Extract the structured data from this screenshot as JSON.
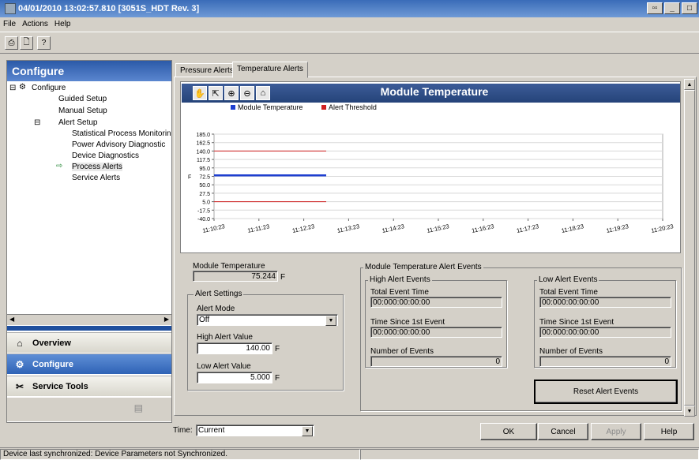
{
  "window": {
    "title": "04/01/2010 13:02:57.810 [3051S_HDT Rev. 3]"
  },
  "menu": [
    "File",
    "Actions",
    "Help"
  ],
  "left": {
    "header": "Configure",
    "tree": [
      "Configure",
      "Guided Setup",
      "Manual Setup",
      "Alert Setup",
      "Statistical Process Monitoring",
      "Power Advisory Diagnostic",
      "Device Diagnostics",
      "Process Alerts",
      "Service Alerts"
    ],
    "nav": {
      "overview": "Overview",
      "configure": "Configure",
      "service_tools": "Service Tools"
    }
  },
  "tabs": [
    "Pressure Alerts",
    "Temperature Alerts"
  ],
  "chart_data": {
    "type": "line",
    "title": "Module Temperature",
    "ylabel": "F",
    "yticks": [
      "185.0",
      "162.5",
      "140.0",
      "117.5",
      "95.0",
      "72.5",
      "50.0",
      "27.5",
      "5.0",
      "-17.5",
      "-40.0"
    ],
    "ylim": [
      -40,
      185
    ],
    "xticks": [
      "11:10:23",
      "11:11:23",
      "11:12:23",
      "11:13:23",
      "11:14:23",
      "11:15:23",
      "11:16:23",
      "11:17:23",
      "11:18:23",
      "11:19:23",
      "11:20:23"
    ],
    "series": [
      {
        "name": "Module Temperature",
        "color": "#1e3fd0",
        "x": [
          "11:10:23",
          "11:12:53"
        ],
        "values": [
          75.244,
          75.244
        ]
      },
      {
        "name": "Alert Threshold",
        "color": "#d02020",
        "x": [
          "11:10:23",
          "11:12:53"
        ],
        "values": [
          140.0,
          140.0
        ]
      },
      {
        "name": "",
        "color": "#d02020",
        "x": [
          "11:10:23",
          "11:12:53"
        ],
        "values": [
          5.0,
          5.0
        ]
      }
    ],
    "grid": true,
    "legend": "top"
  },
  "module_temp": {
    "label": "Module Temperature",
    "value": "75.244",
    "unit": "F"
  },
  "alert_settings": {
    "group": "Alert Settings",
    "mode_label": "Alert Mode",
    "mode_value": "Off",
    "high_label": "High Alert Value",
    "high_value": "140.00",
    "high_unit": "F",
    "low_label": "Low Alert Value",
    "low_value": "5.000",
    "low_unit": "F"
  },
  "events": {
    "group": "Module Temperature Alert Events",
    "high": {
      "title": "High Alert Events",
      "total_label": "Total Event Time",
      "total": "00:000:00:00:00",
      "since_label": "Time Since 1st Event",
      "since": "00:000:00:00:00",
      "count_label": "Number of Events",
      "count": "0"
    },
    "low": {
      "title": "Low Alert Events",
      "total_label": "Total Event Time",
      "total": "00:000:00:00:00",
      "since_label": "Time Since 1st Event",
      "since": "00:000:00:00:00",
      "count_label": "Number of Events",
      "count": "0"
    },
    "reset": "Reset Alert Events"
  },
  "bottom": {
    "time_label": "Time:",
    "time_value": "Current",
    "ok": "OK",
    "cancel": "Cancel",
    "apply": "Apply",
    "help": "Help"
  },
  "status": "Device last synchronized: Device Parameters not Synchronized."
}
